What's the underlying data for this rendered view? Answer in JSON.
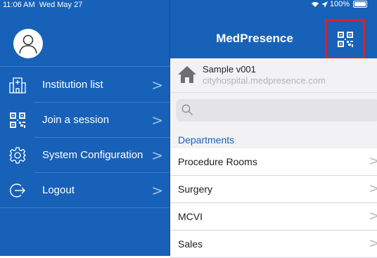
{
  "status_bar": {
    "time": "11:06 AM",
    "date": "Wed May 27",
    "battery": "100%"
  },
  "sidebar": {
    "items": [
      {
        "label": "Institution list",
        "icon": "building-icon"
      },
      {
        "label": "Join a session",
        "icon": "qr-code-icon"
      },
      {
        "label": "System Configuration",
        "icon": "gear-icon"
      },
      {
        "label": "Logout",
        "icon": "logout-icon"
      }
    ],
    "chevron": ">"
  },
  "header": {
    "title": "MedPresence"
  },
  "institution": {
    "name": "Sample v001",
    "url": "cityhospital.medpresence.com"
  },
  "search": {
    "placeholder": ""
  },
  "departments": {
    "heading": "Departments",
    "items": [
      "Procedure Rooms",
      "Surgery",
      "MCVI",
      "Sales"
    ],
    "chevron": ">"
  },
  "colors": {
    "brand": "#1861b8",
    "highlight": "#d5232b"
  }
}
